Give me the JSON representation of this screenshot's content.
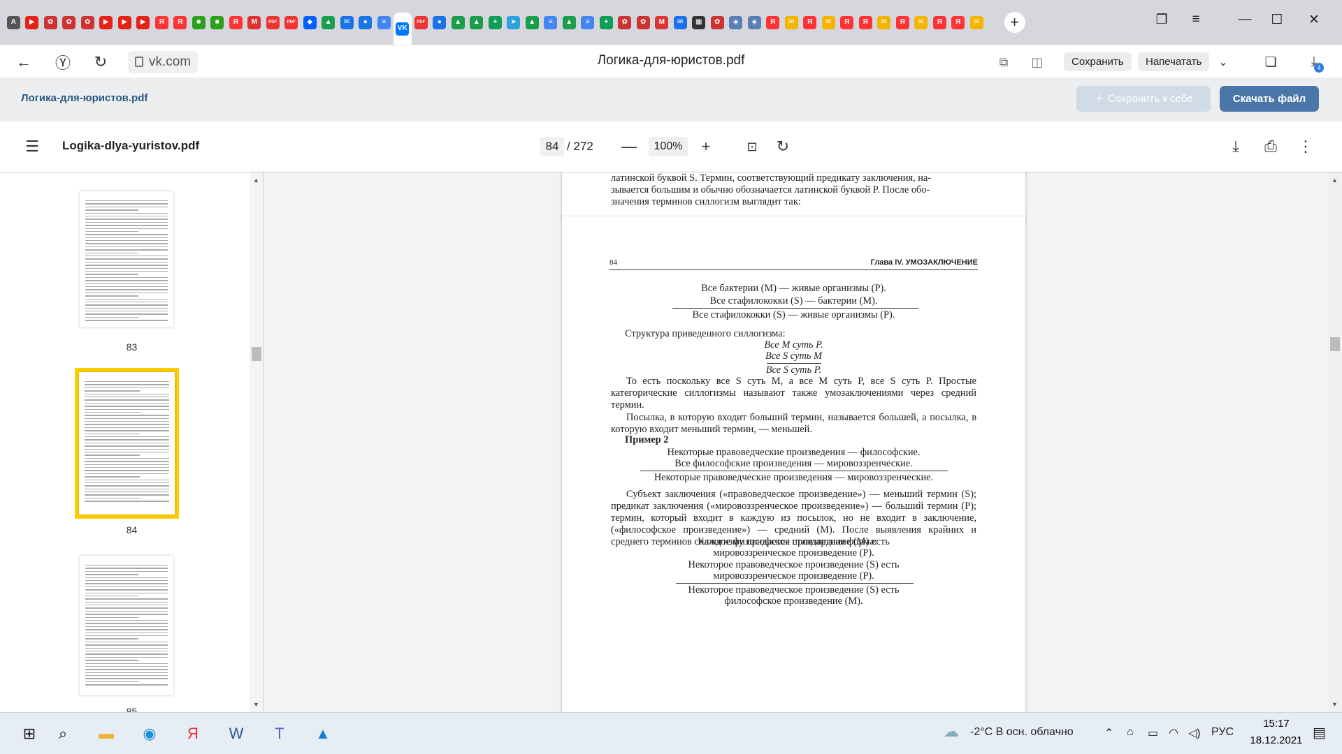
{
  "browser": {
    "tabs": [
      {
        "icon": "translate-icon",
        "glyph": "A",
        "color": "#555"
      },
      {
        "icon": "youtube-icon",
        "glyph": "▶",
        "color": "#e62117"
      },
      {
        "icon": "cherry-icon",
        "glyph": "✿",
        "color": "#c33"
      },
      {
        "icon": "cherry-icon",
        "glyph": "✿",
        "color": "#c33"
      },
      {
        "icon": "cherry-icon",
        "glyph": "✿",
        "color": "#c33"
      },
      {
        "icon": "youtube-icon",
        "glyph": "▶",
        "color": "#e62117"
      },
      {
        "icon": "youtube-icon",
        "glyph": "▶",
        "color": "#e62117"
      },
      {
        "icon": "youtube-icon",
        "glyph": "▶",
        "color": "#e62117"
      },
      {
        "icon": "yandex-icon",
        "glyph": "Я",
        "color": "#f33"
      },
      {
        "icon": "yandex-icon",
        "glyph": "Я",
        "color": "#f33"
      },
      {
        "icon": "microsoft-icon",
        "glyph": "■",
        "color": "#2ca01c"
      },
      {
        "icon": "microsoft-icon",
        "glyph": "■",
        "color": "#2ca01c"
      },
      {
        "icon": "yandex-icon",
        "glyph": "Я",
        "color": "#f33"
      },
      {
        "icon": "gmail-icon",
        "glyph": "M",
        "color": "#d33"
      },
      {
        "icon": "pdf-icon",
        "glyph": "PDF",
        "color": "#e33"
      },
      {
        "icon": "pdf-icon",
        "glyph": "PDF",
        "color": "#e33"
      },
      {
        "icon": "dropbox-icon",
        "glyph": "◆",
        "color": "#0061fe"
      },
      {
        "icon": "google-drive-icon",
        "glyph": "▲",
        "color": "#1a9e4b"
      },
      {
        "icon": "mail-icon",
        "glyph": "✉",
        "color": "#1a73e8"
      },
      {
        "icon": "chat-icon",
        "glyph": "●",
        "color": "#1a73e8"
      },
      {
        "icon": "docs-icon",
        "glyph": "≡",
        "color": "#4285f4"
      },
      {
        "icon": "vk-icon",
        "glyph": "VK",
        "color": "#0077ff"
      },
      {
        "icon": "pdf-icon",
        "glyph": "PDF",
        "color": "#e33"
      },
      {
        "icon": "chat-icon",
        "glyph": "●",
        "color": "#1a73e8"
      },
      {
        "icon": "google-drive-icon",
        "glyph": "▲",
        "color": "#1a9e4b"
      },
      {
        "icon": "google-drive-icon",
        "glyph": "▲",
        "color": "#1a9e4b"
      },
      {
        "icon": "sheets-icon",
        "glyph": "+",
        "color": "#0f9d58"
      },
      {
        "icon": "telegram-icon",
        "glyph": "➤",
        "color": "#2aa3df"
      },
      {
        "icon": "google-drive-icon",
        "glyph": "▲",
        "color": "#1a9e4b"
      },
      {
        "icon": "docs-icon",
        "glyph": "≡",
        "color": "#4285f4"
      },
      {
        "icon": "google-drive-icon",
        "glyph": "▲",
        "color": "#1a9e4b"
      },
      {
        "icon": "docs-icon",
        "glyph": "≡",
        "color": "#4285f4"
      },
      {
        "icon": "sheets-icon",
        "glyph": "+",
        "color": "#0f9d58"
      },
      {
        "icon": "cherry-icon",
        "glyph": "✿",
        "color": "#c33"
      },
      {
        "icon": "cherry-icon",
        "glyph": "✿",
        "color": "#c33"
      },
      {
        "icon": "gmail-icon",
        "glyph": "M",
        "color": "#d33"
      },
      {
        "icon": "mail-icon",
        "glyph": "✉",
        "color": "#1a73e8"
      },
      {
        "icon": "keyboard-icon",
        "glyph": "▦",
        "color": "#333"
      },
      {
        "icon": "cherry-icon",
        "glyph": "✿",
        "color": "#c33"
      },
      {
        "icon": "shield-icon",
        "glyph": "◈",
        "color": "#5a7fb5"
      },
      {
        "icon": "shield-icon",
        "glyph": "◈",
        "color": "#5a7fb5"
      },
      {
        "icon": "yandex-icon",
        "glyph": "Я",
        "color": "#f33"
      },
      {
        "icon": "envelope-icon",
        "glyph": "✉",
        "color": "#f4b400"
      },
      {
        "icon": "yandex-icon",
        "glyph": "Я",
        "color": "#f33"
      },
      {
        "icon": "envelope-icon",
        "glyph": "✉",
        "color": "#f4b400"
      },
      {
        "icon": "yandex-icon",
        "glyph": "Я",
        "color": "#f33"
      },
      {
        "icon": "yandex-icon",
        "glyph": "Я",
        "color": "#f33"
      },
      {
        "icon": "envelope-icon",
        "glyph": "✉",
        "color": "#f4b400"
      },
      {
        "icon": "yandex-icon",
        "glyph": "Я",
        "color": "#f33"
      },
      {
        "icon": "envelope-icon",
        "glyph": "✉",
        "color": "#f4b400"
      },
      {
        "icon": "yandex-icon",
        "glyph": "Я",
        "color": "#f33"
      },
      {
        "icon": "yandex-icon",
        "glyph": "Я",
        "color": "#f33"
      },
      {
        "icon": "envelope-icon",
        "glyph": "✉",
        "color": "#f4b400"
      }
    ],
    "active_tab_index": 21,
    "host": "vk.com",
    "page_title": "Логика-для-юристов.pdf",
    "save_label": "Сохранить",
    "print_label": "Напечатать",
    "downloads_count": "4"
  },
  "vk": {
    "file_title": "Логика-для-юристов.pdf",
    "save_to_self": "Сохранить к себе",
    "download": "Скачать файл"
  },
  "pdf": {
    "filename": "Logika-dlya-yuristov.pdf",
    "current_page": "84",
    "total_pages": "/ 272",
    "zoom": "100%",
    "thumbs": [
      "83",
      "84",
      "85"
    ],
    "prev_page_lines": [
      "латинской буквой S. Термин, соответствующий предикату заключения, на-",
      "зывается большим и обычно обозначается латинской буквой P. После обо-",
      "значения терминов силлогизм выглядит так:"
    ],
    "page": {
      "number": "84",
      "chapter": "Глава IV. УМОЗАКЛЮЧЕНИЕ",
      "syl1": [
        "Все бактерии (M) — живые организмы (P).",
        "Все стафилококки (S) — бактерии (M).",
        "Все стафилококки (S) — живые организмы (P)."
      ],
      "structure_label": "Структура приведенного силлогизма:",
      "structure": [
        "Все M суть P.",
        "Все S суть M",
        "Все S суть P."
      ],
      "para1": "То есть поскольку все S суть M, а все M суть P, все S суть P. Простые категорические силлогизмы называют также умозаключениями через средний термин.",
      "para2": "Посылка, в которую входит больший термин, называется большей, а посылка, в которую входит меньший термин, — меньшей.",
      "example_title": "Пример 2",
      "syl2": [
        "Некоторые правоведческие произведения — философские.",
        "Все философские произведения — мировоззренческие.",
        "Некоторые правоведческие произведения — мировоззренческие."
      ],
      "para3": "Субъект заключения («правоведческое произведение») — меньший термин (S); предикат заключения («мировоззренческое произведение») — больший термин (P); термин, который входит в каждую из посылок, но не входит в заключение, («философское произведение») — средний (M). После выявления крайних и среднего терминов силлогизму придается стандартная форма:",
      "std": [
        "Каждое философское произведение (M) есть",
        "мировоззренческое произведение (P).",
        "Некоторое правоведческое произведение (S) есть",
        "мировоззренческое произведение (P).",
        "Некоторое правоведческое произведение (S) есть",
        "философское произведение (M)."
      ]
    }
  },
  "taskbar": {
    "weather": "-2°C  В осн. облачно",
    "lang": "РУС",
    "time": "15:17",
    "date": "18.12.2021",
    "apps": [
      {
        "name": "windows-start-icon",
        "glyph": "⊞",
        "color": "#111"
      },
      {
        "name": "search-icon",
        "glyph": "⌕",
        "color": "#111"
      },
      {
        "name": "file-explorer-icon",
        "glyph": "▬",
        "color": "#e8b534"
      },
      {
        "name": "edge-icon",
        "glyph": "◉",
        "color": "#1b8fd8"
      },
      {
        "name": "yandex-browser-icon",
        "glyph": "Я",
        "color": "#e33"
      },
      {
        "name": "word-icon",
        "glyph": "W",
        "color": "#2b579a"
      },
      {
        "name": "teams-icon",
        "glyph": "T",
        "color": "#5b5fc7"
      },
      {
        "name": "photos-icon",
        "glyph": "▲",
        "color": "#1b7fd1"
      }
    ]
  }
}
